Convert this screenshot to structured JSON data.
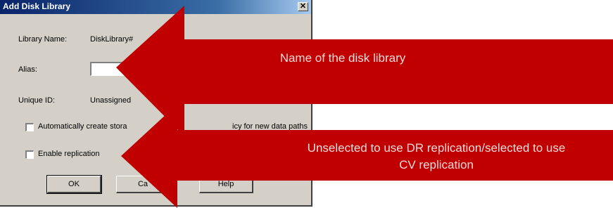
{
  "dialog": {
    "title": "Add Disk Library",
    "close_symbol": "✕",
    "library_name_label": "Library Name:",
    "library_name_value": "DiskLibrary#",
    "alias_label": "Alias:",
    "alias_value": "",
    "unique_id_label": "Unique ID:",
    "unique_id_value": "Unassigned",
    "auto_create_label": "Automatically create stora",
    "auto_create_label_tail": "icy for new data paths",
    "auto_create_checked": false,
    "enable_replication_label": "Enable replication",
    "enable_replication_checked": false,
    "buttons": {
      "ok": "OK",
      "cancel": "Ca",
      "help": "Help"
    }
  },
  "annotations": {
    "top_callout": "Name of the disk library",
    "bottom_callout_line1": "Unselected to use DR replication/selected to use",
    "bottom_callout_line2": "CV replication",
    "color": "#c00000"
  }
}
